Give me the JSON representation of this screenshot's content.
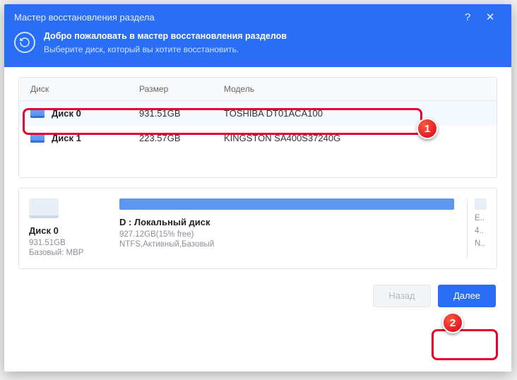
{
  "titlebar": {
    "title": "Мастер восстановления раздела"
  },
  "header": {
    "title": "Добро пожаловать в мастер восстановления разделов",
    "subtitle": "Выберите диск, который вы хотите восстановить."
  },
  "table": {
    "headers": {
      "disk": "Диск",
      "size": "Размер",
      "model": "Модель"
    },
    "rows": [
      {
        "name": "Диск 0",
        "size": "931.51GB",
        "model": "TOSHIBA DT01ACA100",
        "selected": true
      },
      {
        "name": "Диск 1",
        "size": "223.57GB",
        "model": "KINGSTON SA400S37240G",
        "selected": false
      }
    ]
  },
  "detail": {
    "disk": {
      "name": "Диск 0",
      "size": "931.51GB",
      "type": "Базовый: MBP"
    },
    "partition": {
      "name": "D : Локальный диск",
      "size_free": "927.12GB(15% free)",
      "flags": "NTFS,Активный,Базовый"
    },
    "side": {
      "label1": "E..",
      "label2": "4..",
      "label3": "N.."
    }
  },
  "footer": {
    "back": "Назад",
    "next": "Далее"
  },
  "annotations": {
    "badge1": "1",
    "badge2": "2"
  }
}
